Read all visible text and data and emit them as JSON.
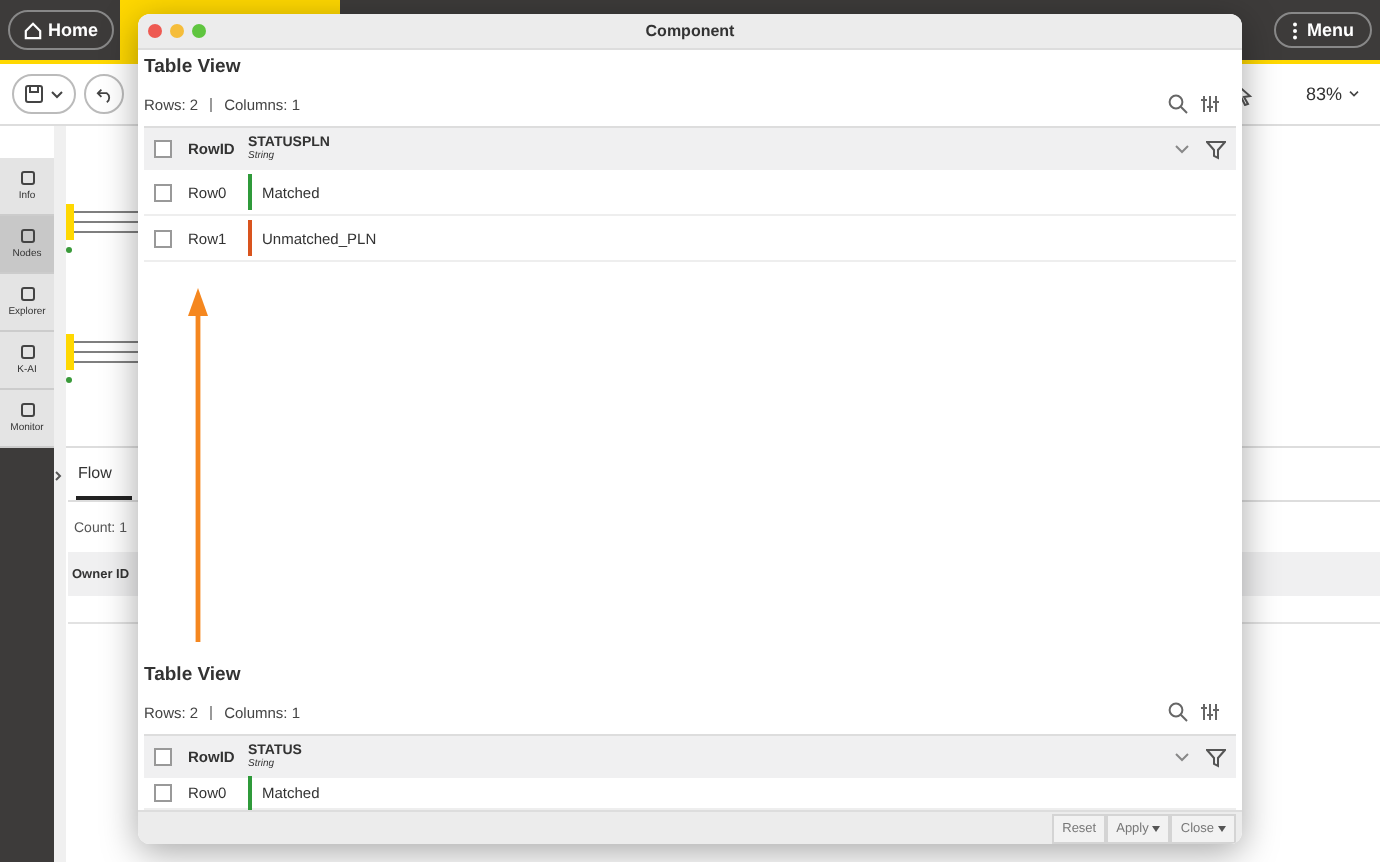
{
  "top_bar": {
    "home": "Home",
    "menu": "Menu"
  },
  "toolbar": {
    "zoom": "83%"
  },
  "sidebar": {
    "items": [
      {
        "label": "Info",
        "selected": false
      },
      {
        "label": "Nodes",
        "selected": true
      },
      {
        "label": "Explorer",
        "selected": false
      },
      {
        "label": "K-AI",
        "selected": false
      },
      {
        "label": "Monitor",
        "selected": false
      }
    ]
  },
  "bottom_panel": {
    "tab": "Flow",
    "count": "Count: 1",
    "column": "Owner ID"
  },
  "dialog": {
    "title": "Component",
    "tables": [
      {
        "title": "Table View",
        "rows_label": "Rows: 2",
        "columns_label": "Columns: 1",
        "select_all_checked": false,
        "row_id_header": "RowID",
        "column": {
          "name": "STATUSPLN",
          "type": "String"
        },
        "rows": [
          {
            "id": "Row0",
            "value": "Matched",
            "color": "#2f9a3a",
            "checked": false
          },
          {
            "id": "Row1",
            "value": "Unmatched_PLN",
            "color": "#d9541e",
            "checked": false
          }
        ]
      },
      {
        "title": "Table View",
        "rows_label": "Rows: 2",
        "columns_label": "Columns: 1",
        "select_all_checked": false,
        "row_id_header": "RowID",
        "column": {
          "name": "STATUS",
          "type": "String"
        },
        "rows": [
          {
            "id": "Row0",
            "value": "Matched",
            "color": "#2f9a3a",
            "checked": false
          }
        ]
      }
    ],
    "buttons": [
      {
        "label": "Reset",
        "dropdown": false
      },
      {
        "label": "Apply",
        "dropdown": true
      },
      {
        "label": "Close",
        "dropdown": true
      }
    ]
  }
}
